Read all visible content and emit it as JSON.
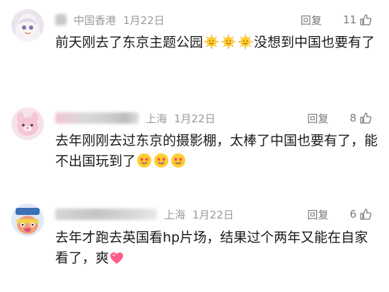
{
  "comments": [
    {
      "region": "中国香港",
      "date": "1月22日",
      "reply_label": "回复",
      "likes": "11",
      "text": "前天刚去了东京主题公园",
      "text_after": "没想到中国也要有了",
      "emojis": [
        "sun-face-icon",
        "sun-face-icon",
        "sun-face-icon"
      ]
    },
    {
      "region": "上海",
      "date": "1月22日",
      "reply_label": "回复",
      "likes": "8",
      "text": "去年刚刚去过东京的摄影棚，太棒了中国也要有了，能不出国玩到了",
      "emojis": [
        "star-struck-face-icon",
        "star-struck-face-icon",
        "star-struck-face-icon"
      ]
    },
    {
      "region": "上海",
      "date": "1月22日",
      "reply_label": "回复",
      "likes": "6",
      "text": "去年才跑去英国看hp片场，结果过个两年又能在自家看了，爽",
      "emojis": [
        "pink-heart-icon"
      ]
    }
  ]
}
